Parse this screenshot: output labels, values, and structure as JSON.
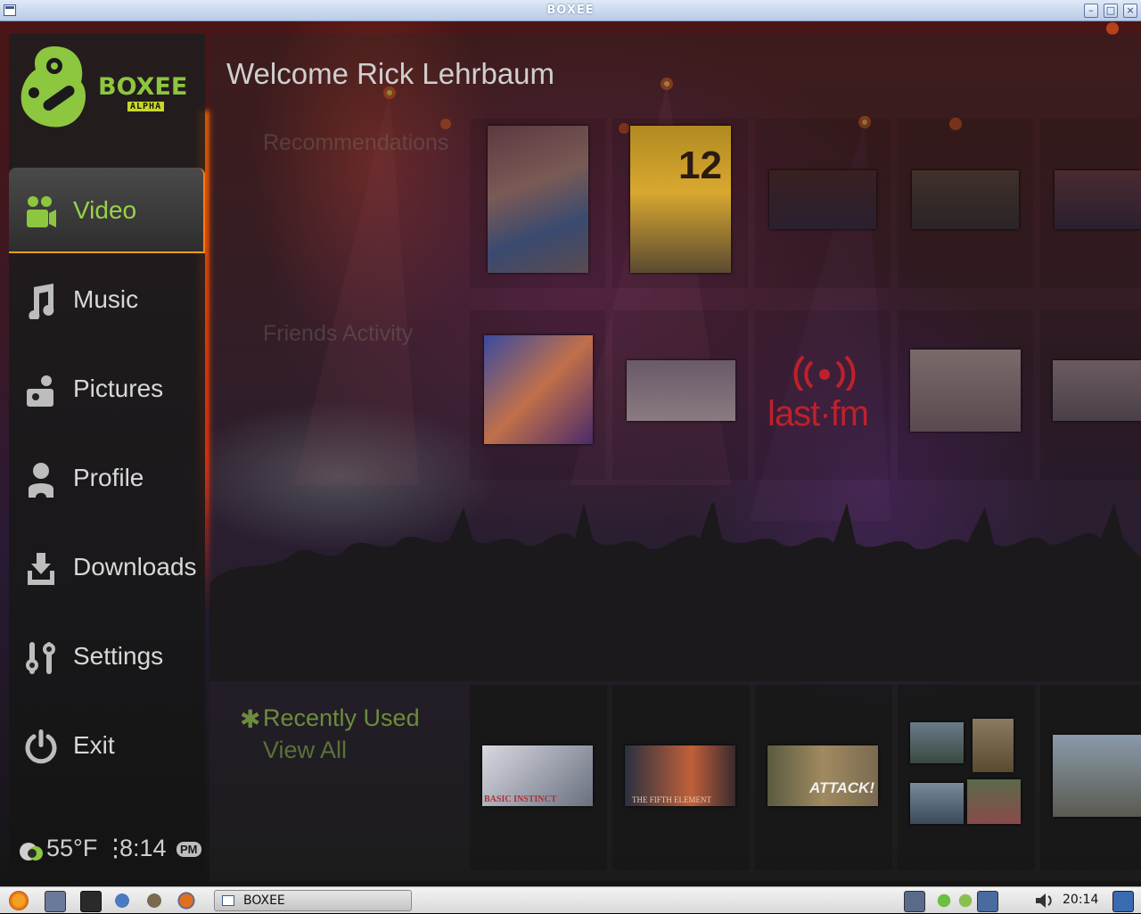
{
  "window": {
    "title": "BOXEE"
  },
  "logo": {
    "name": "BOXEE",
    "tag": "ALPHA"
  },
  "sidebar": {
    "items": [
      {
        "label": "Video",
        "icon": "video-camera-icon",
        "active": true
      },
      {
        "label": "Music",
        "icon": "music-note-icon",
        "active": false
      },
      {
        "label": "Pictures",
        "icon": "camera-icon",
        "active": false
      },
      {
        "label": "Profile",
        "icon": "person-icon",
        "active": false
      },
      {
        "label": "Downloads",
        "icon": "download-icon",
        "active": false
      },
      {
        "label": "Settings",
        "icon": "settings-sliders-icon",
        "active": false
      },
      {
        "label": "Exit",
        "icon": "power-icon",
        "active": false
      }
    ],
    "status": {
      "temperature": "55°F",
      "separator": "⋮",
      "time": "8:14",
      "ampm": "PM"
    }
  },
  "main": {
    "welcome": "Welcome Rick Lehrbaum",
    "recommendations_title": "Recommendations",
    "friends_title": "Friends Activity",
    "recently_used_title": "Recently Used",
    "view_all": "View All",
    "recommendations": [
      "thumb-1",
      "thumb-2",
      "thumb-3",
      "thumb-4",
      "thumb-5"
    ],
    "friends": [
      "thumb-1",
      "thumb-2",
      "thumb-3",
      "thumb-4",
      "thumb-5"
    ],
    "friends_lastfm_label": "last·fm",
    "recent_labels": [
      "BASIC INSTINCT",
      "THE FIFTH ELEMENT",
      "ATTACK!"
    ],
    "recent_count": 5
  },
  "taskbar": {
    "window_button": "BOXEE",
    "clock": "20:14"
  }
}
